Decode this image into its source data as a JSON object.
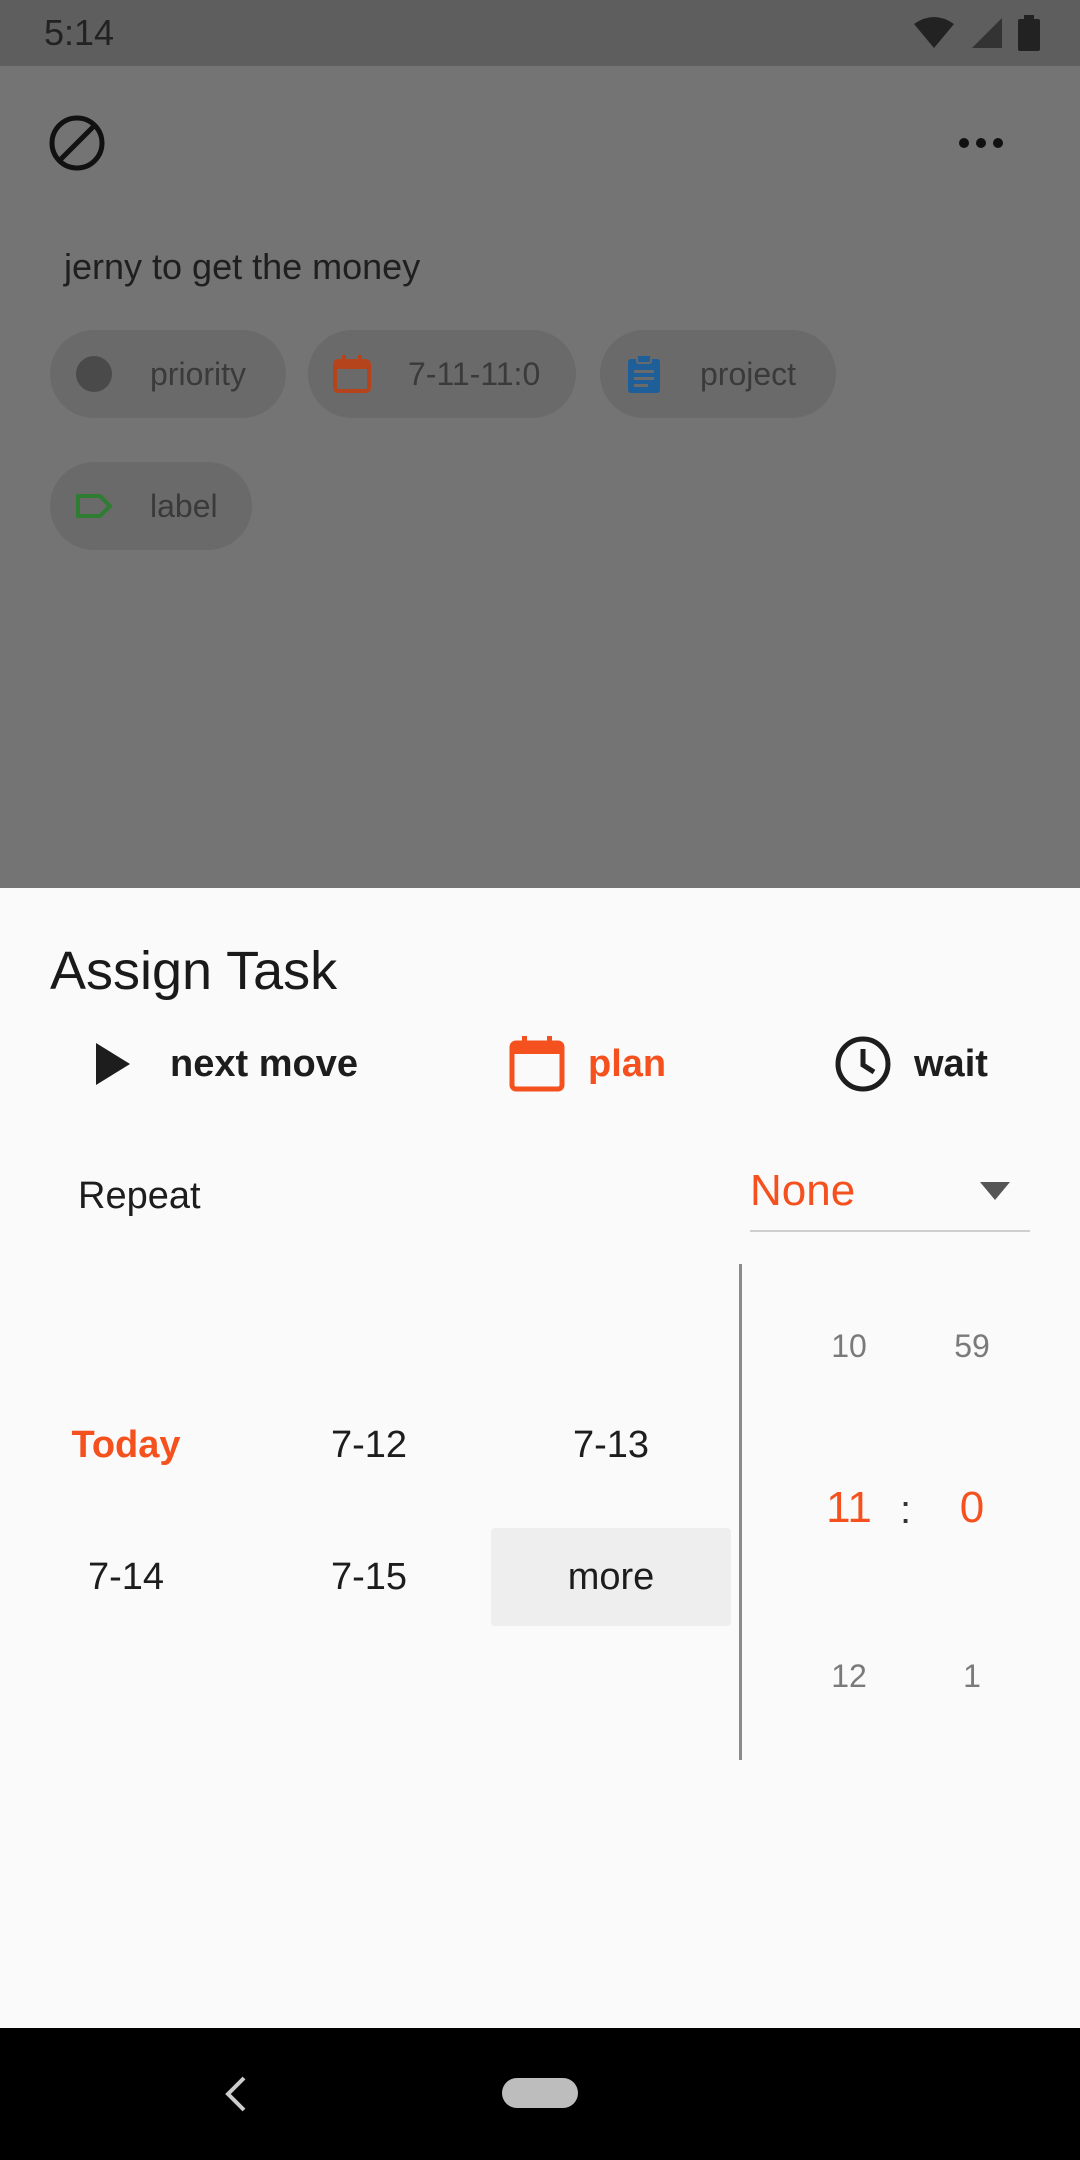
{
  "status_bar": {
    "time": "5:14"
  },
  "task": {
    "title": "jerny to get the money",
    "chips": {
      "priority": "priority",
      "date": "7-11-11:0",
      "project": "project",
      "label": "label"
    }
  },
  "sheet": {
    "title": "Assign Task",
    "modes": {
      "next_move": "next move",
      "plan": "plan",
      "wait": "wait"
    },
    "active_mode": "plan",
    "repeat": {
      "label": "Repeat",
      "value": "None"
    },
    "dates": {
      "today": "Today",
      "d712": "7-12",
      "d713": "7-13",
      "d714": "7-14",
      "d715": "7-15",
      "more": "more"
    },
    "time": {
      "hour_prev": "10",
      "hour": "11",
      "hour_next": "12",
      "minute_prev": "59",
      "minute": "0",
      "minute_next": "1",
      "separator": ":"
    }
  },
  "colors": {
    "accent": "#f4511e",
    "project_blue": "#1e6fbf",
    "label_green": "#2e7d32",
    "priority_gray": "#4a4a4a"
  }
}
